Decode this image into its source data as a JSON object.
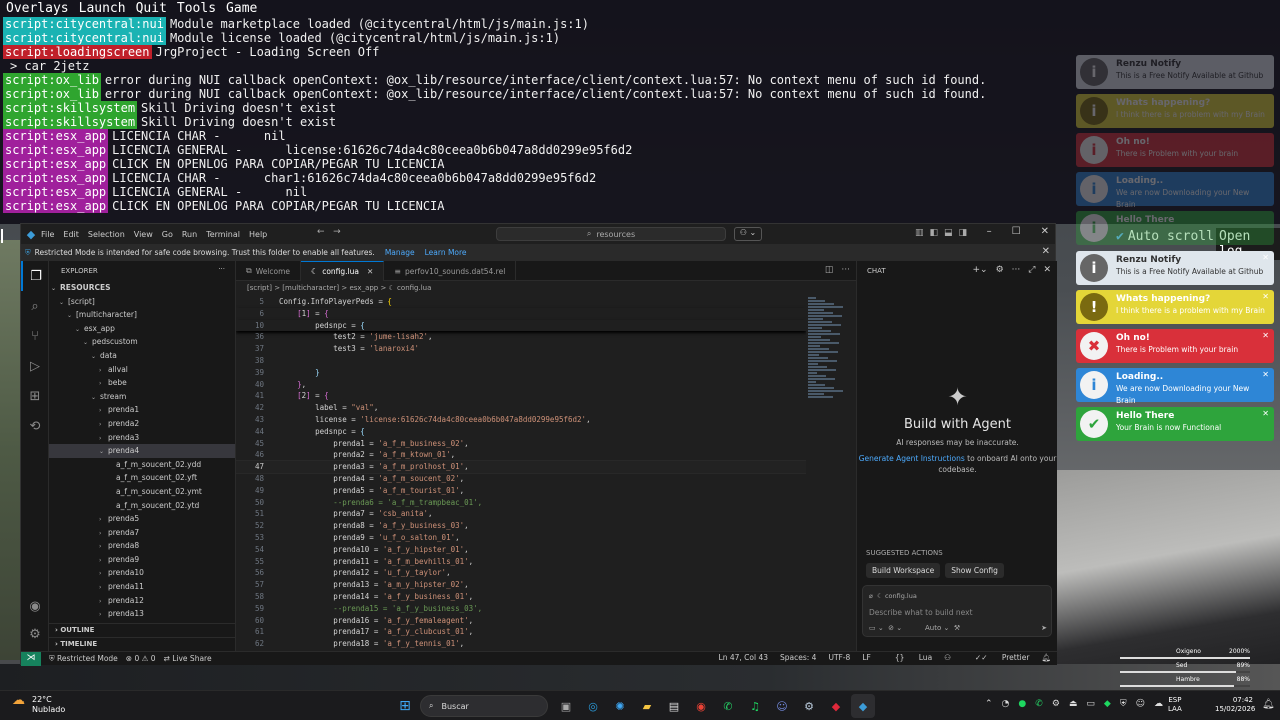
{
  "console": {
    "menu": [
      "Overlays",
      "Launch",
      "Quit",
      "Tools",
      "Game"
    ],
    "lines": [
      {
        "tag": "script:citycentral:nui",
        "color": "cyan",
        "text": "Module marketplace loaded (@citycentral/html/js/main.js:1)"
      },
      {
        "tag": "script:citycentral:nui",
        "color": "cyan",
        "text": "Module license loaded (@citycentral/html/js/main.js:1)"
      },
      {
        "tag": "script:loadingscreen",
        "color": "red",
        "text": "JrgProject - Loading Screen Off"
      },
      {
        "tag": "",
        "color": "",
        "text": "> car 2jetz"
      },
      {
        "tag": "script:ox_lib",
        "color": "green",
        "text": "error during NUI callback openContext: @ox_lib/resource/interface/client/context.lua:57: No context menu of such id found."
      },
      {
        "tag": "script:ox_lib",
        "color": "green",
        "text": "error during NUI callback openContext: @ox_lib/resource/interface/client/context.lua:57: No context menu of such id found."
      },
      {
        "tag": "script:skillsystem",
        "color": "green",
        "text": "Skill Driving doesn't exist"
      },
      {
        "tag": "script:skillsystem",
        "color": "green",
        "text": "Skill Driving doesn't exist"
      },
      {
        "tag": "script:esx_app",
        "color": "magenta",
        "text": "LICENCIA CHAR -      nil"
      },
      {
        "tag": "script:esx_app",
        "color": "magenta",
        "text": "LICENCIA GENERAL -      license:61626c74da4c80ceea0b6b047a8dd0299e95f6d2"
      },
      {
        "tag": "script:esx_app",
        "color": "magenta",
        "text": "CLICK EN OPENLOG PARA COPIAR/PEGAR TU LICENCIA"
      },
      {
        "tag": "script:esx_app",
        "color": "magenta",
        "text": "LICENCIA CHAR -      char1:61626c74da4c80ceea0b6b047a8dd0299e95f6d2"
      },
      {
        "tag": "script:esx_app",
        "color": "magenta",
        "text": "LICENCIA GENERAL -      nil"
      },
      {
        "tag": "script:esx_app",
        "color": "magenta",
        "text": "CLICK EN OPENLOG PARA COPIAR/PEGAR TU LICENCIA"
      }
    ],
    "auto_scroll": "Auto scroll",
    "open_log": "Open log"
  },
  "notifications_faded": [
    {
      "type": "info",
      "title": "Renzu Notify",
      "msg": "This is a Free Notify Available at Github"
    },
    {
      "type": "warn",
      "title": "Whats happening?",
      "msg": "I think there is a problem with my Brain"
    },
    {
      "type": "err",
      "title": "Oh no!",
      "msg": "There is Problem with your brain"
    },
    {
      "type": "load",
      "title": "Loading..",
      "msg": "We are now Downloading your New Brain"
    },
    {
      "type": "ok",
      "title": "Hello There",
      "msg": ""
    }
  ],
  "notifications": [
    {
      "type": "info",
      "title": "Renzu Notify",
      "msg": "This is a Free Notify Available at Github",
      "icon": "i"
    },
    {
      "type": "warn",
      "title": "Whats happening?",
      "msg": "I think there is a problem with my Brain",
      "icon": "!"
    },
    {
      "type": "err",
      "title": "Oh no!",
      "msg": "There is Problem with your brain",
      "icon": "✖"
    },
    {
      "type": "load",
      "title": "Loading..",
      "msg": "We are now Downloading your New Brain",
      "icon": "i"
    },
    {
      "type": "ok",
      "title": "Hello There",
      "msg": "Your Brain is now Functional",
      "icon": "✔"
    }
  ],
  "vscode": {
    "menu": [
      "File",
      "Edit",
      "Selection",
      "View",
      "Go",
      "Run",
      "Terminal",
      "Help"
    ],
    "search": "resources",
    "banner": {
      "text": "Restricted Mode is intended for safe code browsing. Trust this folder to enable all features.",
      "manage": "Manage",
      "learn": "Learn More"
    },
    "explorer_title": "EXPLORER",
    "tree": [
      {
        "label": "RESOURCES",
        "depth": 0,
        "chev": "⌄",
        "bold": true
      },
      {
        "label": "[script]",
        "depth": 1,
        "chev": "⌄"
      },
      {
        "label": "[multicharacter]",
        "depth": 2,
        "chev": "⌄"
      },
      {
        "label": "esx_app",
        "depth": 3,
        "chev": "⌄"
      },
      {
        "label": "pedscustom",
        "depth": 4,
        "chev": "⌄"
      },
      {
        "label": "data",
        "depth": 5,
        "chev": "⌄"
      },
      {
        "label": "allval",
        "depth": 6,
        "chev": "›"
      },
      {
        "label": "bebe",
        "depth": 6,
        "chev": "›"
      },
      {
        "label": "stream",
        "depth": 5,
        "chev": "⌄"
      },
      {
        "label": "prenda1",
        "depth": 6,
        "chev": "›"
      },
      {
        "label": "prenda2",
        "depth": 6,
        "chev": "›"
      },
      {
        "label": "prenda3",
        "depth": 6,
        "chev": "›"
      },
      {
        "label": "prenda4",
        "depth": 6,
        "chev": "⌄",
        "sel": true
      },
      {
        "label": "a_f_m_soucent_02.ydd",
        "depth": 7,
        "chev": ""
      },
      {
        "label": "a_f_m_soucent_02.yft",
        "depth": 7,
        "chev": ""
      },
      {
        "label": "a_f_m_soucent_02.ymt",
        "depth": 7,
        "chev": ""
      },
      {
        "label": "a_f_m_soucent_02.ytd",
        "depth": 7,
        "chev": ""
      },
      {
        "label": "prenda5",
        "depth": 6,
        "chev": "›"
      },
      {
        "label": "prenda7",
        "depth": 6,
        "chev": "›"
      },
      {
        "label": "prenda8",
        "depth": 6,
        "chev": "›"
      },
      {
        "label": "prenda9",
        "depth": 6,
        "chev": "›"
      },
      {
        "label": "prenda10",
        "depth": 6,
        "chev": "›"
      },
      {
        "label": "prenda11",
        "depth": 6,
        "chev": "›"
      },
      {
        "label": "prenda12",
        "depth": 6,
        "chev": "›"
      },
      {
        "label": "prenda13",
        "depth": 6,
        "chev": "›"
      }
    ],
    "outline": "OUTLINE",
    "timeline": "TIMELINE",
    "tabs": [
      {
        "label": "Welcome",
        "icon": "⧉",
        "active": false
      },
      {
        "label": "config.lua",
        "icon": "☾",
        "active": true
      },
      {
        "label": "perfov10_sounds.dat54.rel",
        "icon": "≡",
        "active": false
      }
    ],
    "breadcrumb": "[script] > [multicharacter] > esx_app > ☾ config.lua",
    "code": [
      {
        "n": "5",
        "html": "<span class='w'>Config.InfoPlayerPeds = </span><span class='y'>{</span>",
        "sticky": true
      },
      {
        "n": "6",
        "html": "    <span class='b'>[</span><span class='w'>1</span><span class='b'>]</span><span class='w'> = </span><span class='b'>{</span>",
        "sticky": true
      },
      {
        "n": "10",
        "html": "        <span class='w'>pedsnpc = </span><span class='k'>{</span>",
        "sticky": true
      },
      {
        "n": "36",
        "html": "            <span class='w'>test2 = </span><span class='s'>'jume-lisah2'</span><span class='w'>,</span>"
      },
      {
        "n": "37",
        "html": "            <span class='w'>test3 = </span><span class='s'>'lanaroxi4'</span>"
      },
      {
        "n": "38",
        "html": ""
      },
      {
        "n": "39",
        "html": "        <span class='k'>}</span>"
      },
      {
        "n": "40",
        "html": "    <span class='b'>}</span><span class='w'>,</span>"
      },
      {
        "n": "41",
        "html": "    <span class='b'>[</span><span class='w'>2</span><span class='b'>]</span><span class='w'> = </span><span class='b'>{</span>"
      },
      {
        "n": "42",
        "html": "        <span class='w'>label = </span><span class='s'>\"val\"</span><span class='w'>,</span>"
      },
      {
        "n": "43",
        "html": "        <span class='w'>license = </span><span class='s'>'license:61626c74da4c80ceea0b6b047a8dd0299e95f6d2'</span><span class='w'>,</span>"
      },
      {
        "n": "44",
        "html": "        <span class='w'>pedsnpc = </span><span class='k'>{</span>"
      },
      {
        "n": "45",
        "html": "            <span class='w'>prenda1 = </span><span class='s'>'a_f_m_business_02'</span><span class='w'>,</span>"
      },
      {
        "n": "46",
        "html": "            <span class='w'>prenda2 = </span><span class='s'>'a_f_m_ktown_01'</span><span class='w'>,</span>"
      },
      {
        "n": "47",
        "html": "            <span class='w'>prenda3 = </span><span class='s'>'a_f_m_prolhost_01'</span><span class='w'>,</span>",
        "cur": true
      },
      {
        "n": "48",
        "html": "            <span class='w'>prenda4 = </span><span class='s'>'a_f_m_soucent_02'</span><span class='w'>,</span>"
      },
      {
        "n": "49",
        "html": "            <span class='w'>prenda5 = </span><span class='s'>'a_f_m_tourist_01'</span><span class='w'>,</span>"
      },
      {
        "n": "50",
        "html": "            <span class='c'>--prenda6 = 'a_f_m_trampbeac_01',</span>"
      },
      {
        "n": "51",
        "html": "            <span class='w'>prenda7 = </span><span class='s'>'csb_anita'</span><span class='w'>,</span>"
      },
      {
        "n": "52",
        "html": "            <span class='w'>prenda8 = </span><span class='s'>'a_f_y_business_03'</span><span class='w'>,</span>"
      },
      {
        "n": "53",
        "html": "            <span class='w'>prenda9 = </span><span class='s'>'u_f_o_salton_01'</span><span class='w'>,</span>"
      },
      {
        "n": "54",
        "html": "            <span class='w'>prenda10 = </span><span class='s'>'a_f_y_hipster_01'</span><span class='w'>,</span>"
      },
      {
        "n": "55",
        "html": "            <span class='w'>prenda11 = </span><span class='s'>'a_f_m_bevhills_01'</span><span class='w'>,</span>"
      },
      {
        "n": "56",
        "html": "            <span class='w'>prenda12 = </span><span class='s'>'u_f_y_taylor'</span><span class='w'>,</span>"
      },
      {
        "n": "57",
        "html": "            <span class='w'>prenda13 = </span><span class='s'>'a_m_y_hipster_02'</span><span class='w'>,</span>"
      },
      {
        "n": "58",
        "html": "            <span class='w'>prenda14 = </span><span class='s'>'a_f_y_business_01'</span><span class='w'>,</span>"
      },
      {
        "n": "59",
        "html": "            <span class='c'>--prenda15 = 'a_f_y_business_03',</span>"
      },
      {
        "n": "60",
        "html": "            <span class='w'>prenda16 = </span><span class='s'>'a_f_y_femaleagent'</span><span class='w'>,</span>"
      },
      {
        "n": "61",
        "html": "            <span class='w'>prenda17 = </span><span class='s'>'a_f_y_clubcust_01'</span><span class='w'>,</span>"
      },
      {
        "n": "62",
        "html": "            <span class='w'>prenda18 = </span><span class='s'>'a_f_y_tennis_01'</span><span class='w'>,</span>"
      }
    ],
    "chat": {
      "title": "CHAT",
      "heading": "Build with Agent",
      "sub": "AI responses may be inaccurate.",
      "link": "Generate Agent Instructions",
      "rest": "to onboard AI onto your codebase.",
      "suggested": "SUGGESTED ACTIONS",
      "actions": [
        "Build Workspace",
        "Show Config"
      ],
      "context": "config.lua",
      "placeholder": "Describe what to build next",
      "mode": "Auto"
    },
    "status": {
      "errors": "0",
      "warnings": "0",
      "restricted": "Restricted Mode",
      "liveshare": "Live Share",
      "position": "Ln 47, Col 43",
      "spaces": "Spaces: 4",
      "encoding": "UTF-8",
      "eol": "LF",
      "lang": "Lua",
      "prettier": "Prettier"
    }
  },
  "hud": [
    {
      "label": "Oxigeno",
      "value": "2000%",
      "fraction": 1.0
    },
    {
      "label": "Sed",
      "value": "89%",
      "fraction": 0.89
    },
    {
      "label": "Hambre",
      "value": "88%",
      "fraction": 0.88
    }
  ],
  "taskbar": {
    "temp": "22°C",
    "weather": "Nublado",
    "search": "Buscar",
    "lang1": "ESP",
    "lang2": "LAA",
    "time": "07:42",
    "date": "15/02/2026"
  }
}
